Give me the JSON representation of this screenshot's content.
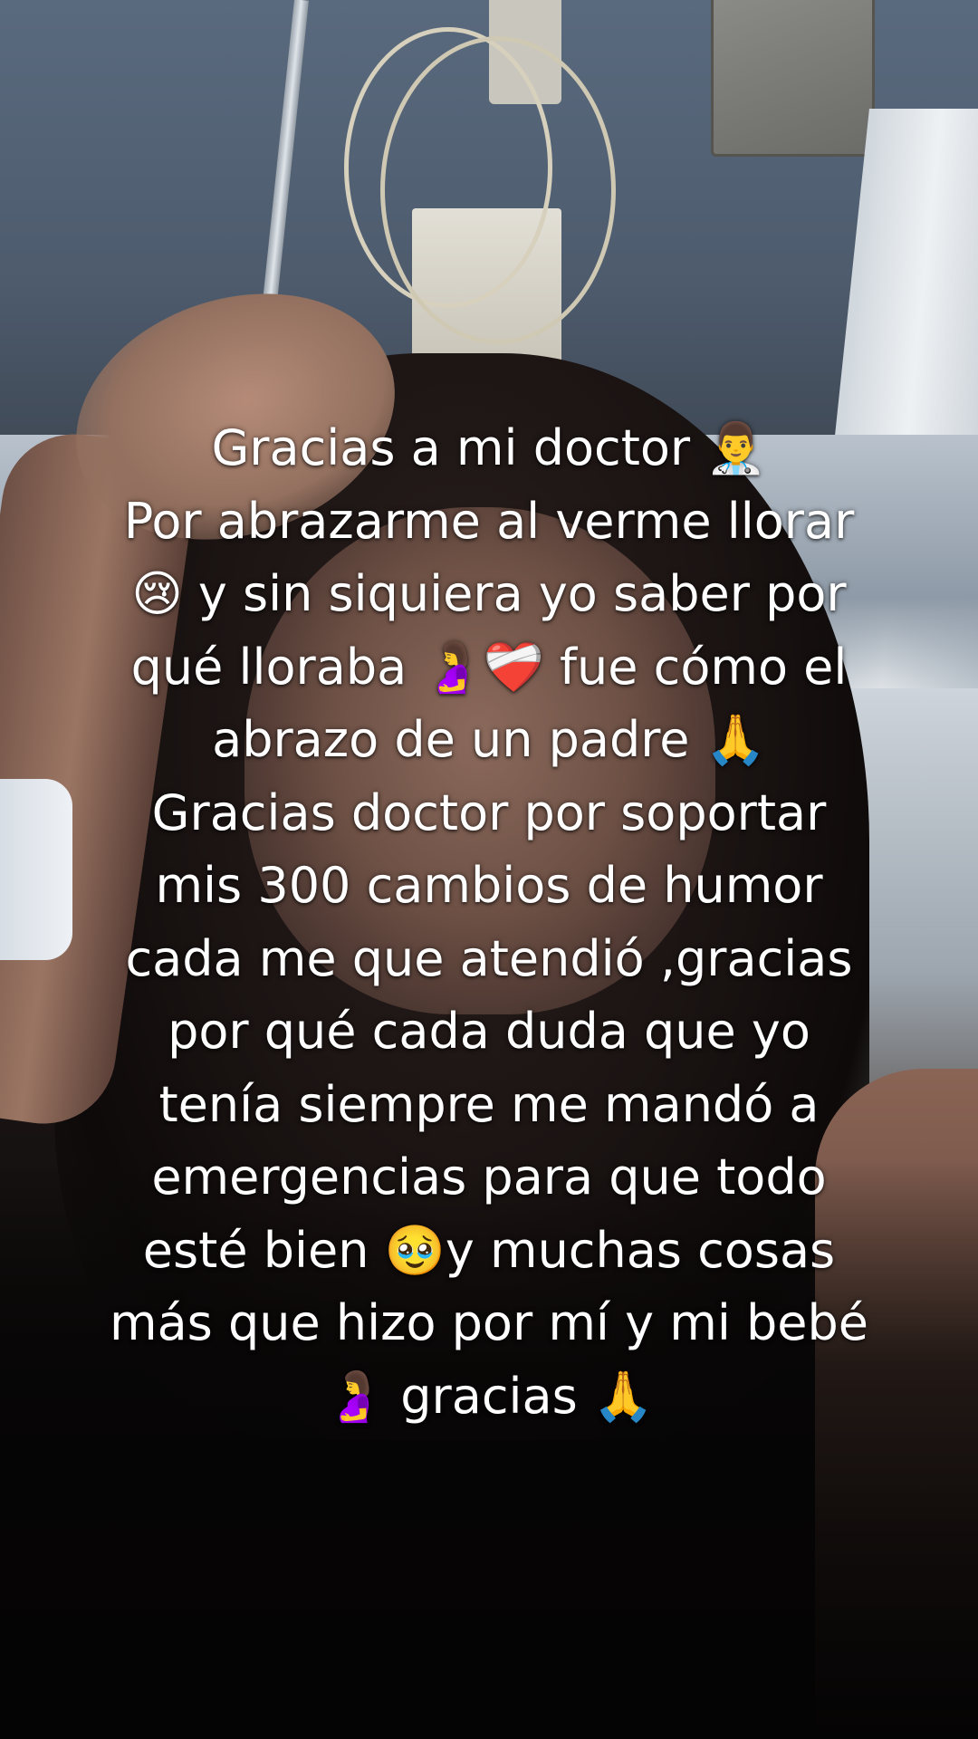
{
  "caption": {
    "lines": [
      "Gracias a mi doctor 👨‍⚕️",
      "Por abrazarme al verme llorar",
      "😢 y sin siquiera  yo saber por",
      "qué lloraba 🤰❤️‍🩹 fue cómo el",
      "abrazo de un padre 🙏",
      "Gracias doctor por soportar",
      "mis 300 cambios de humor",
      "cada me que atendió ,gracias",
      "por qué cada duda que yo",
      "tenía siempre me mandó a",
      "emergencias para que todo",
      "esté bien 🥹y muchas cosas",
      "más que hizo por mí y mi bebé",
      "🤰 gracias 🙏"
    ]
  }
}
